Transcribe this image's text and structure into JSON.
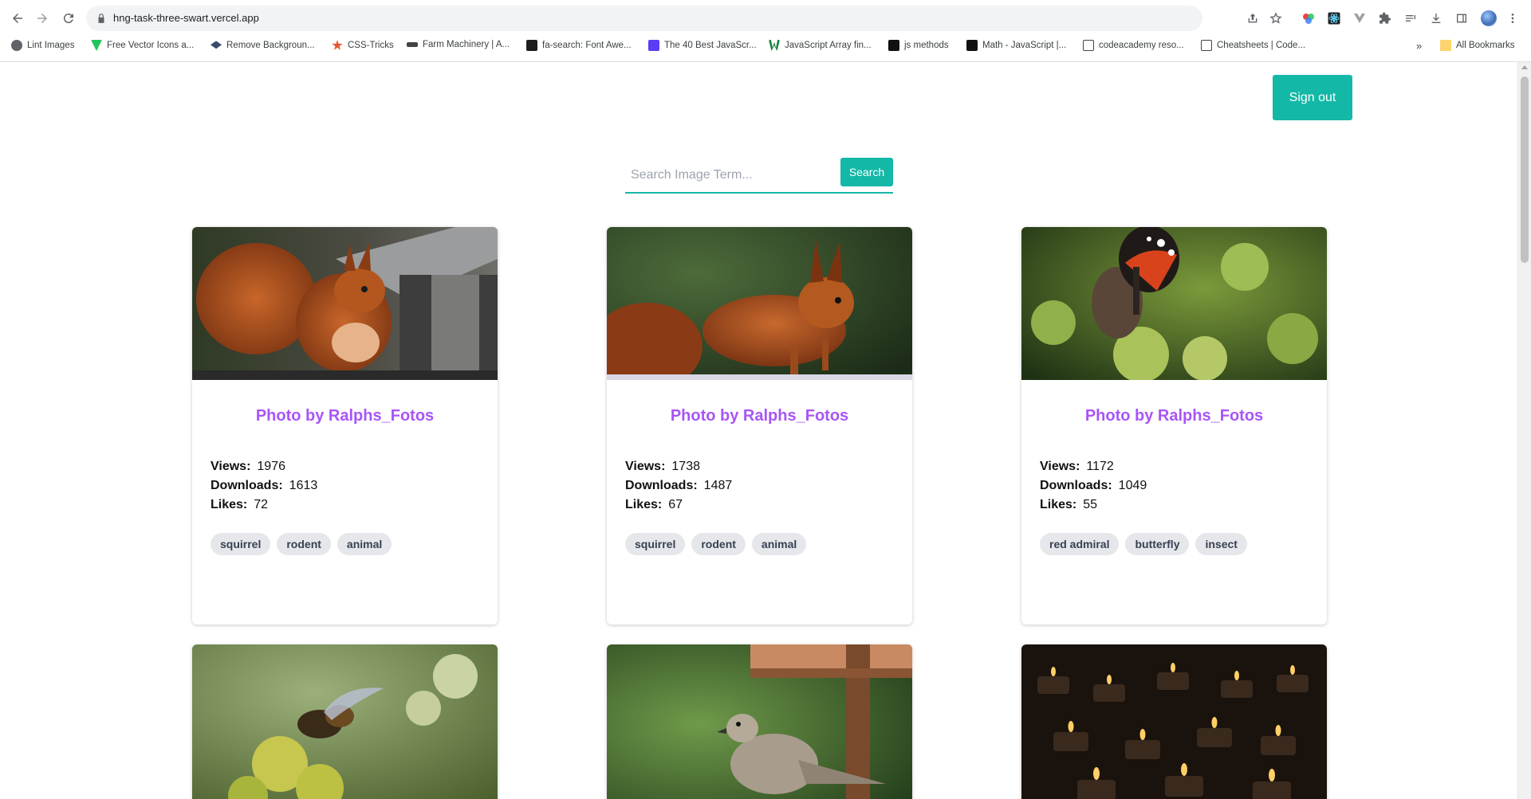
{
  "browser": {
    "url": "hng-task-three-swart.vercel.app",
    "bookmarks": [
      {
        "label": "Lint Images",
        "color": "#5f6368"
      },
      {
        "label": "Free Vector Icons a...",
        "color": "#22c55e"
      },
      {
        "label": "Remove Backgroun...",
        "color": "#3b4a6b"
      },
      {
        "label": "CSS-Tricks",
        "color": "#e4572e"
      },
      {
        "label": "Farm Machinery | A...",
        "color": "#444444"
      },
      {
        "label": "fa-search: Font Awe...",
        "color": "#1e1e1e"
      },
      {
        "label": "The 40 Best JavaScr...",
        "color": "#5b3df5"
      },
      {
        "label": "JavaScript Array fin...",
        "color": "#15803d"
      },
      {
        "label": "js methods",
        "color": "#111111"
      },
      {
        "label": "Math - JavaScript |...",
        "color": "#111111"
      },
      {
        "label": "codeacademy reso...",
        "color": "#444444"
      },
      {
        "label": "Cheatsheets | Code...",
        "color": "#444444"
      }
    ],
    "overflow_label": "»",
    "all_bookmarks": "All Bookmarks"
  },
  "header": {
    "signout_label": "Sign out"
  },
  "search": {
    "placeholder": "Search Image Term...",
    "button_label": "Search"
  },
  "stat_labels": {
    "views": "Views:",
    "downloads": "Downloads:",
    "likes": "Likes:"
  },
  "cards": [
    {
      "title": "Photo by Ralphs_Fotos",
      "views": "1976",
      "downloads": "1613",
      "likes": "72",
      "tags": [
        "squirrel",
        "rodent",
        "animal"
      ],
      "image": "red squirrel eating"
    },
    {
      "title": "Photo by Ralphs_Fotos",
      "views": "1738",
      "downloads": "1487",
      "likes": "67",
      "tags": [
        "squirrel",
        "rodent",
        "animal"
      ],
      "image": "red squirrel side view"
    },
    {
      "title": "Photo by Ralphs_Fotos",
      "views": "1172",
      "downloads": "1049",
      "likes": "55",
      "tags": [
        "red admiral",
        "butterfly",
        "insect"
      ],
      "image": "red admiral butterfly on ivy"
    },
    {
      "image": "bee on ivy flowers"
    },
    {
      "image": "collared dove"
    },
    {
      "image": "tea light candles"
    }
  ],
  "colors": {
    "accent": "#14b8a6",
    "title": "#a855f7",
    "tag_bg": "#e5e7eb"
  }
}
